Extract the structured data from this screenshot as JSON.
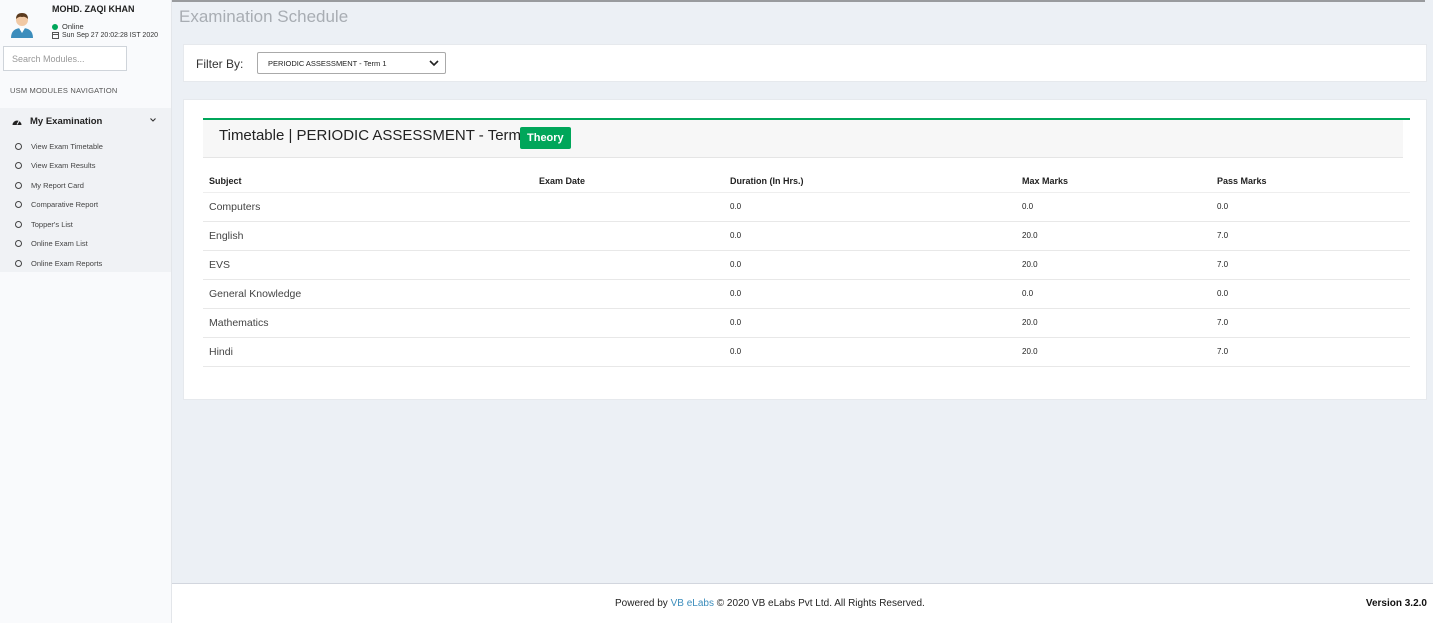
{
  "user": {
    "name": "MOHD. ZAQI KHAN",
    "status": "Online",
    "datetime": "Sun Sep 27 20:02:28 IST 2020"
  },
  "sidebar": {
    "search_placeholder": "Search Modules...",
    "nav_header": "USM MODULES NAVIGATION",
    "section_title": "My Examination",
    "items": [
      {
        "label": "View Exam Timetable"
      },
      {
        "label": "View Exam Results"
      },
      {
        "label": "My Report Card"
      },
      {
        "label": "Comparative Report"
      },
      {
        "label": "Topper's List"
      },
      {
        "label": "Online Exam List"
      },
      {
        "label": "Online Exam Reports"
      }
    ]
  },
  "page": {
    "title": "Examination Schedule"
  },
  "filter": {
    "label": "Filter By:",
    "selected": "PERIODIC ASSESSMENT - Term 1"
  },
  "timetable": {
    "title": "Timetable | PERIODIC ASSESSMENT - Term 1",
    "badge": "Theory",
    "columns": [
      "Subject",
      "Exam Date",
      "Duration (In Hrs.)",
      "Max Marks",
      "Pass Marks"
    ],
    "rows": [
      {
        "subject": "Computers",
        "exam_date": "",
        "duration": "0.0",
        "max_marks": "0.0",
        "pass_marks": "0.0"
      },
      {
        "subject": "English",
        "exam_date": "",
        "duration": "0.0",
        "max_marks": "20.0",
        "pass_marks": "7.0"
      },
      {
        "subject": "EVS",
        "exam_date": "",
        "duration": "0.0",
        "max_marks": "20.0",
        "pass_marks": "7.0"
      },
      {
        "subject": "General Knowledge",
        "exam_date": "",
        "duration": "0.0",
        "max_marks": "0.0",
        "pass_marks": "0.0"
      },
      {
        "subject": "Mathematics",
        "exam_date": "",
        "duration": "0.0",
        "max_marks": "20.0",
        "pass_marks": "7.0"
      },
      {
        "subject": "Hindi",
        "exam_date": "",
        "duration": "0.0",
        "max_marks": "20.0",
        "pass_marks": "7.0"
      }
    ]
  },
  "footer": {
    "powered_by": "Powered by",
    "company_link": "VB eLabs",
    "copyright": "© 2020 VB eLabs Pvt Ltd. All Rights Reserved.",
    "version": "Version 3.2.0"
  },
  "colors": {
    "accent_green": "#00a65a",
    "link_blue": "#3c8dbc"
  }
}
